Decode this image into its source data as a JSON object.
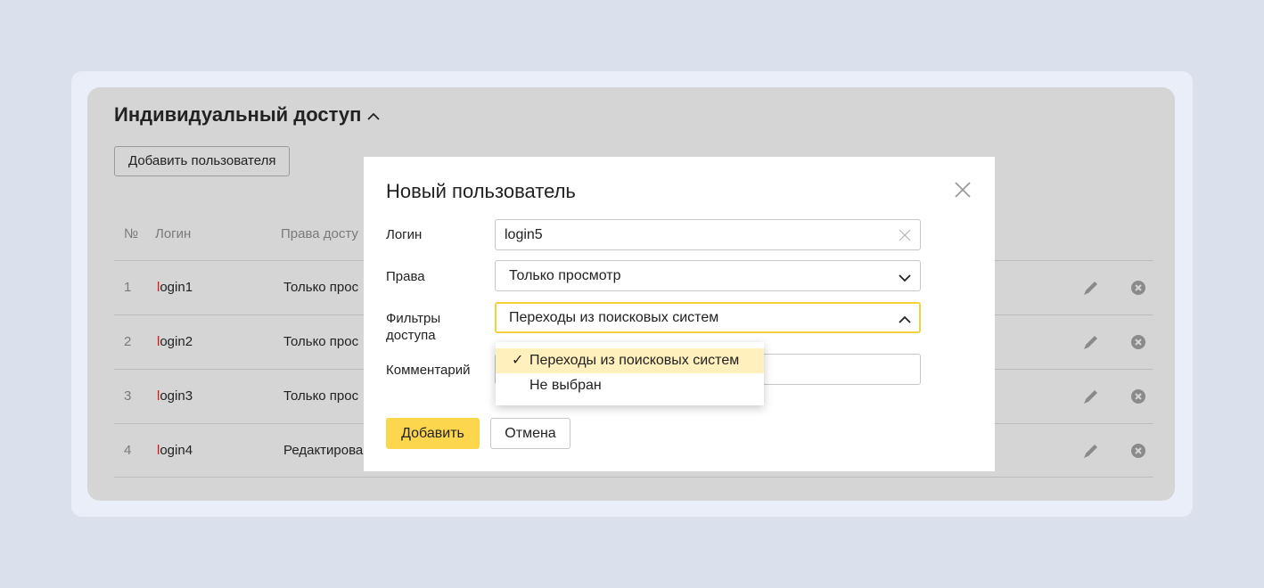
{
  "section": {
    "title": "Индивидуальный доступ",
    "add_user_label": "Добавить пользователя"
  },
  "table": {
    "headers": {
      "num": "№",
      "login": "Логин",
      "rights": "Права досту"
    },
    "rows": [
      {
        "num": "1",
        "login_first": "l",
        "login_rest": "ogin1",
        "rights": "Только прос"
      },
      {
        "num": "2",
        "login_first": "l",
        "login_rest": "ogin2",
        "rights": "Только прос"
      },
      {
        "num": "3",
        "login_first": "l",
        "login_rest": "ogin3",
        "rights": "Только прос"
      },
      {
        "num": "4",
        "login_first": "l",
        "login_rest": "ogin4",
        "rights": "Редактирова"
      }
    ]
  },
  "modal": {
    "title": "Новый пользователь",
    "login_label": "Логин",
    "login_value": "login5",
    "rights_label": "Права",
    "rights_value": "Только просмотр",
    "filters_label_line1": "Фильтры",
    "filters_label_line2": "доступа",
    "filters_value": "Переходы из поисковых систем",
    "comment_label": "Комментарий",
    "comment_value": "",
    "dropdown_options": [
      {
        "check": "✓",
        "label": "Переходы из поисковых систем",
        "selected": true
      },
      {
        "check": "",
        "label": "Не выбран",
        "selected": false
      }
    ],
    "submit_label": "Добавить",
    "cancel_label": "Отмена"
  },
  "icons": {
    "collapse": "chevron-up-icon",
    "close": "close-icon",
    "clear": "clear-icon",
    "select_closed": "chevron-down-icon",
    "select_open": "chevron-up-icon",
    "edit": "pencil-icon",
    "delete": "remove-circle-icon"
  },
  "colors": {
    "accent_yellow": "#fcd64c",
    "focus_border": "#f5d23c",
    "option_highlight": "#fff0bd",
    "login_first_letter": "#ee1111"
  }
}
